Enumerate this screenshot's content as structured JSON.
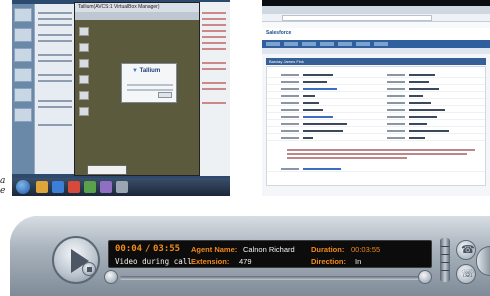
{
  "remote_desktop": {
    "vm_window_title": "Tallium(AVCS:1 VirtualBox Manager)",
    "dialog_brand": "Tallium"
  },
  "crm": {
    "logo": "Salesforce",
    "record_title": "Barclay James Fink"
  },
  "captions": {
    "fragment_1": "a",
    "fragment_2": "e"
  },
  "player": {
    "time_current": "00:04",
    "time_separator": "/",
    "time_total": "03:55",
    "status": "Video during call",
    "agent_name_label": "Agent Name:",
    "agent_name_value": "Calnon Richard",
    "duration_label": "Duration:",
    "duration_value": "00:03:55",
    "extension_label": "Extension:",
    "extension_value": "479",
    "direction_label": "Direction:",
    "direction_value": "In",
    "phone_icon": "phone-icon",
    "hangup_icon": "hangup-icon",
    "accent_color": "#f28a1a"
  }
}
